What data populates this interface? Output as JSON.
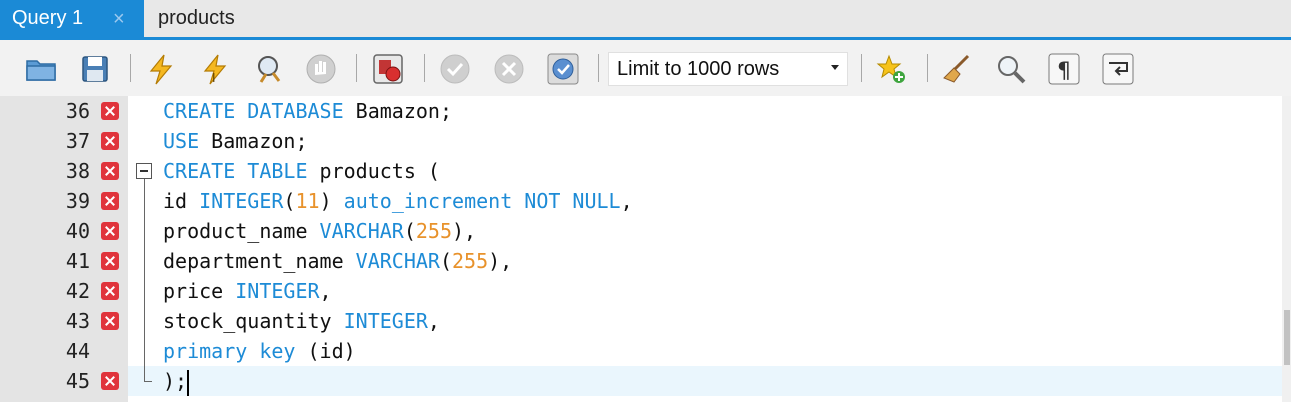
{
  "tabs": [
    {
      "label": "Query 1",
      "active": true,
      "close_glyph": "×"
    },
    {
      "label": "products",
      "active": false
    }
  ],
  "toolbar": {
    "icons": [
      "open-folder-icon",
      "save-icon",
      "execute-lightning-icon",
      "execute-current-lightning-icon",
      "explain-magnifier-icon",
      "stop-hand-icon",
      "toggle-error-stop-icon",
      "commit-check-icon",
      "rollback-x-icon",
      "autocommit-toggle-icon",
      "add-snippet-star-icon",
      "beautify-broom-icon",
      "find-magnifier-icon",
      "invisible-chars-pilcrow-icon",
      "word-wrap-icon"
    ],
    "limit_select": {
      "value": "Limit to 1000 rows"
    }
  },
  "editor": {
    "lines": [
      {
        "num": "36",
        "error": true,
        "code": "<span class=\"kw\">CREATE DATABASE</span> Bamazon;"
      },
      {
        "num": "37",
        "error": true,
        "code": "<span class=\"kw\">USE</span> Bamazon;"
      },
      {
        "num": "38",
        "error": true,
        "code": "<span class=\"kw\">CREATE TABLE</span> products ("
      },
      {
        "num": "39",
        "error": true,
        "code": "id <span class=\"kw\">INTEGER</span>(<span class=\"num\">11</span>) <span class=\"kw\">auto_increment NOT NULL</span>,"
      },
      {
        "num": "40",
        "error": true,
        "code": "product_name <span class=\"kw\">VARCHAR</span>(<span class=\"num\">255</span>),"
      },
      {
        "num": "41",
        "error": true,
        "code": "department_name <span class=\"kw\">VARCHAR</span>(<span class=\"num\">255</span>),"
      },
      {
        "num": "42",
        "error": true,
        "code": "price <span class=\"kw\">INTEGER</span>,"
      },
      {
        "num": "43",
        "error": true,
        "code": "stock_quantity <span class=\"kw\">INTEGER</span>,"
      },
      {
        "num": "44",
        "error": false,
        "code": "<span class=\"kw\">primary key</span> (id)"
      },
      {
        "num": "45",
        "error": true,
        "code": ");<span class=\"caret\"></span>"
      }
    ]
  },
  "colors": {
    "accent": "#1b8ad6",
    "keyword": "#1d8bd6",
    "number": "#e8922b",
    "error": "#e0343c"
  }
}
